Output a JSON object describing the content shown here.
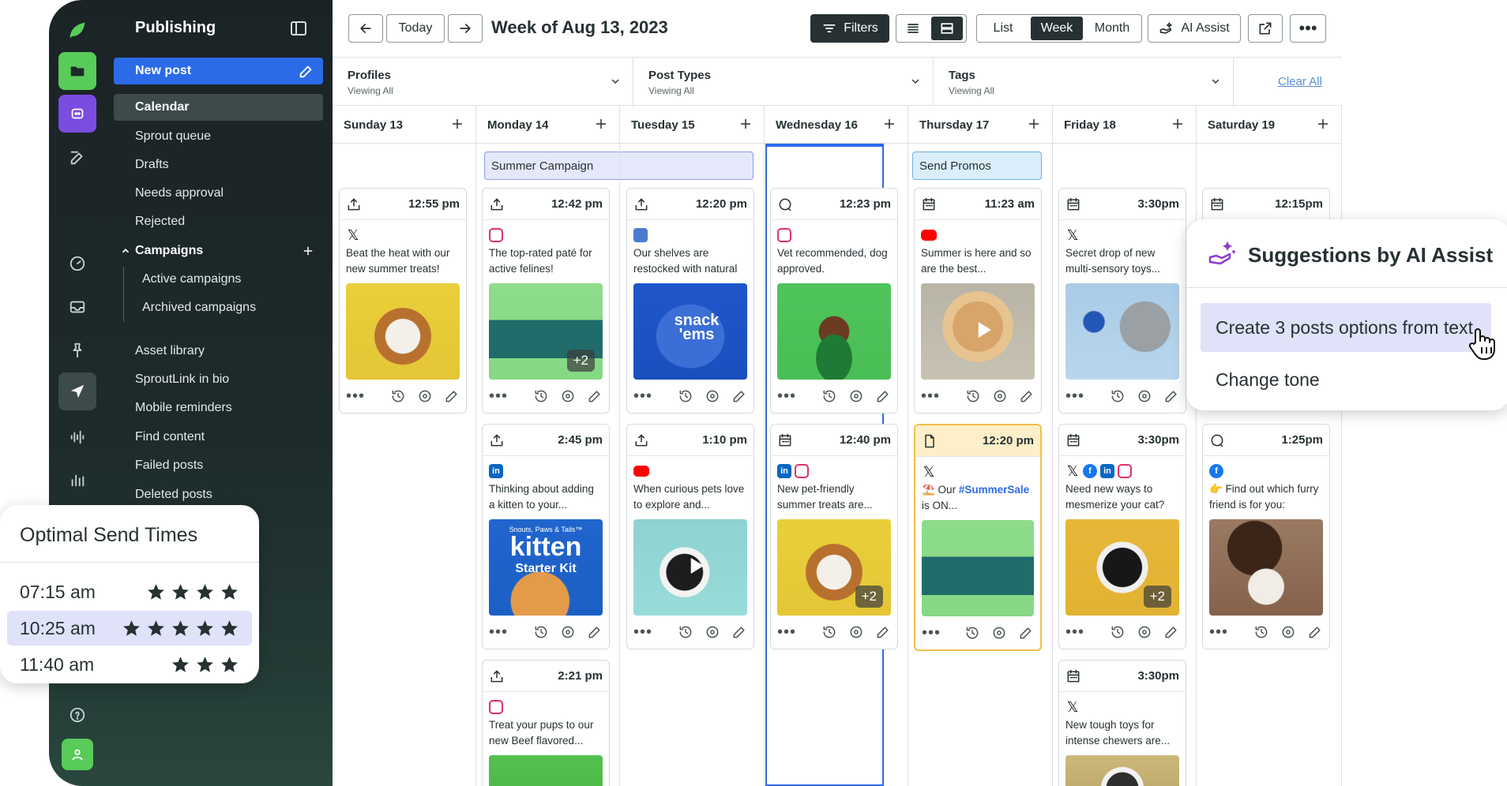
{
  "sidebar": {
    "title": "Publishing",
    "new_post": "New post",
    "items": [
      {
        "label": "Calendar"
      },
      {
        "label": "Sprout queue"
      },
      {
        "label": "Drafts"
      },
      {
        "label": "Needs approval"
      },
      {
        "label": "Rejected"
      },
      {
        "label": "Campaigns"
      },
      {
        "label": "Active campaigns"
      },
      {
        "label": "Archived campaigns"
      },
      {
        "label": "Asset library"
      },
      {
        "label": "SproutLink in bio"
      },
      {
        "label": "Mobile reminders"
      },
      {
        "label": "Find content"
      },
      {
        "label": "Failed posts"
      },
      {
        "label": "Deleted posts"
      }
    ]
  },
  "toolbar": {
    "today": "Today",
    "week_title": "Week of Aug 13, 2023",
    "filters": "Filters",
    "views": [
      "List",
      "Week",
      "Month"
    ],
    "active_view": "Week",
    "ai_assist": "AI Assist"
  },
  "filters": {
    "profiles": {
      "label": "Profiles",
      "sub": "Viewing All"
    },
    "post_types": {
      "label": "Post Types",
      "sub": "Viewing All"
    },
    "tags": {
      "label": "Tags",
      "sub": "Viewing All"
    },
    "clear_all": "Clear All"
  },
  "days": [
    "Sunday 13",
    "Monday 14",
    "Tuesday 15",
    "Wednesday 16",
    "Thursday 17",
    "Friday 18",
    "Saturday 19"
  ],
  "campaigns": [
    {
      "label": "Summer Campaign"
    },
    {
      "label": "Send Promos"
    }
  ],
  "posts": [
    {
      "time": "12:55 pm",
      "networks": [
        "x"
      ],
      "text": "Beat the heat with our new summer treats!",
      "image": "dog-yellow",
      "extra": ""
    },
    {
      "time": "12:42 pm",
      "networks": [
        "ig"
      ],
      "text": "The top-rated paté for active felines!",
      "image": "cans-green",
      "extra": "+2"
    },
    {
      "time": "12:20 pm",
      "networks": [
        "gb"
      ],
      "text": "Our shelves are restocked with natural",
      "image": "bag-blue",
      "extra": ""
    },
    {
      "time": "12:23 pm",
      "networks": [
        "ig"
      ],
      "text": "Vet recommended, dog approved.",
      "image": "bowl-green",
      "extra": ""
    },
    {
      "time": "11:23 am",
      "networks": [
        "yt"
      ],
      "text": "Summer is here and so are the best...",
      "image": "dog-toy",
      "extra": ""
    },
    {
      "time": "3:30pm",
      "networks": [
        "x"
      ],
      "text": "Secret drop of new multi-sensory toys...",
      "image": "husky-blue",
      "extra": ""
    },
    {
      "time": "12:15pm",
      "networks": [],
      "text": "",
      "image": "",
      "extra": ""
    },
    {
      "time": "2:45 pm",
      "networks": [
        "li"
      ],
      "text": "Thinking about adding a kitten to your...",
      "image": "kitten-kit",
      "extra": ""
    },
    {
      "time": "1:10 pm",
      "networks": [
        "yt"
      ],
      "text": "When curious pets love to explore and...",
      "image": "cat-teal",
      "extra": ""
    },
    {
      "time": "12:40 pm",
      "networks": [
        "li",
        "ig"
      ],
      "text": "New pet-friendly summer treats are...",
      "image": "dog-yellow",
      "extra": "+2"
    },
    {
      "time": "12:20 pm",
      "networks": [
        "x"
      ],
      "text_pre": "⛱️ Our ",
      "text_tag": "#SummerSale",
      "text_post": " is ON...",
      "image": "cans-green",
      "extra": ""
    },
    {
      "time": "3:30pm",
      "networks": [
        "x",
        "fb",
        "li",
        "ig"
      ],
      "text": "Need new ways to mesmerize your cat?",
      "image": "cat-yellow",
      "extra": "+2"
    },
    {
      "time": "1:25pm",
      "networks": [
        "fb"
      ],
      "text": "👉 Find out which furry friend is for you:",
      "image": "woman-dog",
      "extra": ""
    },
    {
      "time": "2:21 pm",
      "networks": [
        "ig"
      ],
      "text": "Treat your pups to our new Beef flavored...",
      "image": "green-bag",
      "extra": ""
    },
    {
      "time": "3:30pm",
      "networks": [
        "x"
      ],
      "text": "New tough toys for intense chewers are...",
      "image": "dog-field",
      "extra": ""
    }
  ],
  "image_text": {
    "snack": "snack 'ems",
    "kitten_small": "Snouts, Paws & Tails™",
    "kitten_big": "kitten",
    "kitten_kit": "Starter Kit"
  },
  "optimal": {
    "title": "Optimal Send Times",
    "rows": [
      {
        "time": "07:15 am",
        "stars": 4
      },
      {
        "time": "10:25 am",
        "stars": 5
      },
      {
        "time": "11:40 am",
        "stars": 3
      }
    ]
  },
  "ai_panel": {
    "title": "Suggestions by AI Assist",
    "options": [
      "Create 3 posts options from text",
      "Change tone"
    ]
  },
  "colors": {
    "accent": "#2b6be8",
    "dark": "#273133",
    "highlight": "#dfe2f8"
  }
}
